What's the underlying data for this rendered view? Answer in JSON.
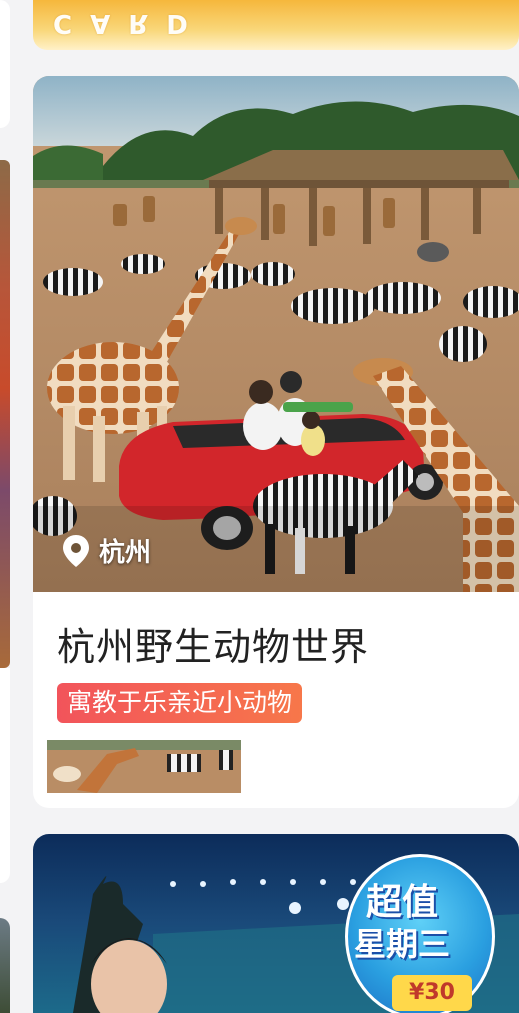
{
  "top_banner": {
    "text": "CARD",
    "gradient": [
      "#f6b73c",
      "#fff1c8"
    ]
  },
  "attraction": {
    "location": "杭州",
    "name": "杭州野生动物世界",
    "tag": "寓教于乐亲近小动物",
    "tag_color": "#f2545b",
    "hero_image": "safari-giraffes-zebras-red-car",
    "pin_icon": "location-pin-icon"
  },
  "next_card": {
    "promo_line1": "超值",
    "promo_line2": "星期三",
    "coupon": "¥30"
  }
}
